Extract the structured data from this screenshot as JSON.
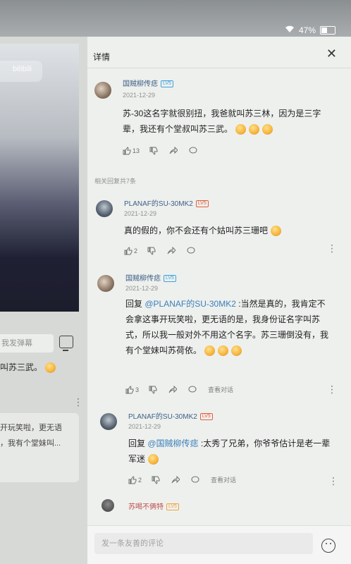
{
  "status": {
    "battery": "47%"
  },
  "left_pane": {
    "watermark": "bilibili",
    "danmu_placeholder": "我发弹幕",
    "snippet1": "叫苏三武。",
    "snippet2": "开玩笑啦，更无语",
    "snippet3": "，我有个堂妹叫..."
  },
  "panel": {
    "title": "详情",
    "related_count": "相关回复共7条",
    "reply_placeholder": "发一条友善的评论",
    "view_conversation": "查看对话"
  },
  "comments": [
    {
      "user": "国贼柳传痣",
      "level": "LV5",
      "date": "2021-12-29",
      "text": "苏-30这名字就很别扭，我爸就叫苏三林，因为是三字辈，我还有个堂叔叫苏三武。",
      "likes": "13"
    },
    {
      "user": "PLANAF的SU-30MK2",
      "level": "LV5",
      "date": "2021-12-29",
      "text": "真的假的，你不会还有个姑叫苏三珊吧",
      "likes": "2"
    },
    {
      "user": "国贼柳传痣",
      "level": "LV5",
      "date": "2021-12-29",
      "prefix": "回复 ",
      "mention": "@PLANAF的SU-30MK2",
      "text": " :当然是真的，我肯定不会拿这事开玩笑啦，更无语的是，我身份证名字叫苏式，所以我一般对外不用这个名字。苏三珊倒没有，我有个堂妹叫苏荷依。",
      "likes": "3"
    },
    {
      "user": "PLANAF的SU-30MK2",
      "level": "LV5",
      "date": "2021-12-29",
      "prefix": "回复 ",
      "mention": "@国贼柳传痣",
      "text": " :太秀了兄弟，你爷爷估计是老一辈军迷",
      "likes": "2"
    },
    {
      "user": "苏喝不俩特",
      "level": "LV5"
    }
  ]
}
